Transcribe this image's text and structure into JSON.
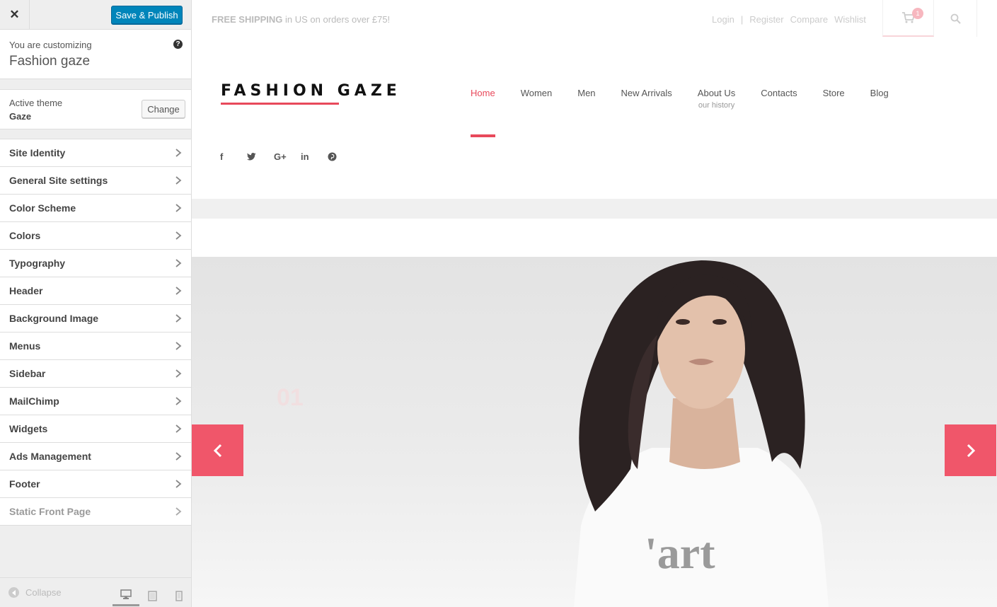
{
  "customizer": {
    "save_label": "Save & Publish",
    "customizing_label": "You are customizing",
    "site_name": "Fashion gaze",
    "active_theme_label": "Active theme",
    "theme_name": "Gaze",
    "change_label": "Change",
    "sections": [
      {
        "label": "Site Identity"
      },
      {
        "label": "General Site settings"
      },
      {
        "label": "Color Scheme"
      },
      {
        "label": "Colors"
      },
      {
        "label": "Typography"
      },
      {
        "label": "Header"
      },
      {
        "label": "Background Image"
      },
      {
        "label": "Menus"
      },
      {
        "label": "Sidebar"
      },
      {
        "label": "MailChimp"
      },
      {
        "label": "Widgets"
      },
      {
        "label": "Ads Management"
      },
      {
        "label": "Footer"
      },
      {
        "label": "Static Front Page"
      }
    ],
    "collapse_label": "Collapse",
    "accent_color": "#0085ba"
  },
  "site": {
    "shipping_bold": "FREE SHIPPING",
    "shipping_rest": " in US on orders over £75!",
    "top_links": {
      "login": "Login",
      "separator": "|",
      "register": "Register",
      "compare": "Compare",
      "wishlist": "Wishlist"
    },
    "cart_count": "1",
    "logo": "FASHION GAZE",
    "nav": [
      {
        "label": "Home",
        "active": true
      },
      {
        "label": "Women"
      },
      {
        "label": "Men"
      },
      {
        "label": "New Arrivals"
      },
      {
        "label": "About Us",
        "sub": "our history"
      },
      {
        "label": "Contacts"
      },
      {
        "label": "Store"
      },
      {
        "label": "Blog"
      }
    ],
    "social": {
      "facebook": "f",
      "twitter": "twitter",
      "googleplus": "G+",
      "linkedin": "in",
      "pinterest": "pinterest"
    },
    "hero": {
      "slide_number": "01",
      "shirt_text": "'art"
    },
    "accent_color": "#e8495b"
  }
}
